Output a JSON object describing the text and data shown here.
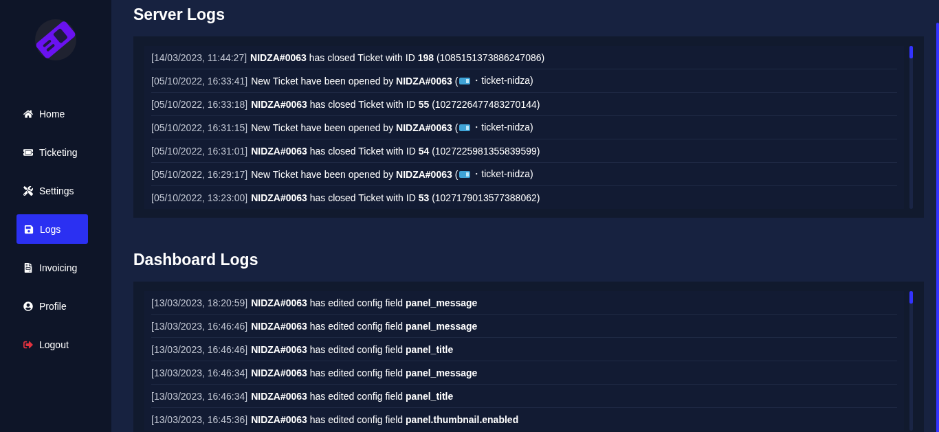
{
  "sidebar": {
    "items": [
      {
        "label": "Home",
        "selected": false
      },
      {
        "label": "Ticketing",
        "selected": false
      },
      {
        "label": "Settings",
        "selected": false
      },
      {
        "label": "Logs",
        "selected": true
      },
      {
        "label": "Invoicing",
        "selected": false
      },
      {
        "label": "Profile",
        "selected": false
      },
      {
        "label": "Logout",
        "selected": false
      }
    ]
  },
  "sections": [
    {
      "title": "Server Logs",
      "entries": [
        {
          "kind": "plain",
          "time": "[14/03/2023, 11:44:27]",
          "text": "**NIDZA#0063** has closed Ticket with ID **198** (1085151373886247086)"
        },
        {
          "kind": "channel",
          "time": "[05/10/2022, 16:33:41]",
          "text": "New Ticket have been opened by **NIDZA#0063** (",
          "channel": "・ticket-nidza)"
        },
        {
          "kind": "plain",
          "time": "[05/10/2022, 16:33:18]",
          "text": "**NIDZA#0063** has closed Ticket with ID **55** (1027226477483270144)"
        },
        {
          "kind": "channel",
          "time": "[05/10/2022, 16:31:15]",
          "text": "New Ticket have been opened by **NIDZA#0063** (",
          "channel": "・ticket-nidza)"
        },
        {
          "kind": "plain",
          "time": "[05/10/2022, 16:31:01]",
          "text": "**NIDZA#0063** has closed Ticket with ID **54** (1027225981355839599)"
        },
        {
          "kind": "channel",
          "time": "[05/10/2022, 16:29:17]",
          "text": "New Ticket have been opened by **NIDZA#0063** (",
          "channel": "・ticket-nidza)"
        },
        {
          "kind": "plain",
          "time": "[05/10/2022, 13:23:00]",
          "text": "**NIDZA#0063** has closed Ticket with ID **53** (1027179013577388062)"
        }
      ]
    },
    {
      "title": "Dashboard Logs",
      "entries": [
        {
          "kind": "plain",
          "time": "[13/03/2023, 18:20:59]",
          "text": "**NIDZA#0063** has edited config field **panel_message**"
        },
        {
          "kind": "plain",
          "time": "[13/03/2023, 16:46:46]",
          "text": "**NIDZA#0063** has edited config field **panel_message**"
        },
        {
          "kind": "plain",
          "time": "[13/03/2023, 16:46:46]",
          "text": "**NIDZA#0063** has edited config field **panel_title**"
        },
        {
          "kind": "plain",
          "time": "[13/03/2023, 16:46:34]",
          "text": "**NIDZA#0063** has edited config field **panel_message**"
        },
        {
          "kind": "plain",
          "time": "[13/03/2023, 16:46:34]",
          "text": "**NIDZA#0063** has edited config field **panel_title**"
        },
        {
          "kind": "plain",
          "time": "[13/03/2023, 16:45:36]",
          "text": "**NIDZA#0063** has edited config field **panel.thumbnail.enabled**"
        }
      ]
    }
  ]
}
